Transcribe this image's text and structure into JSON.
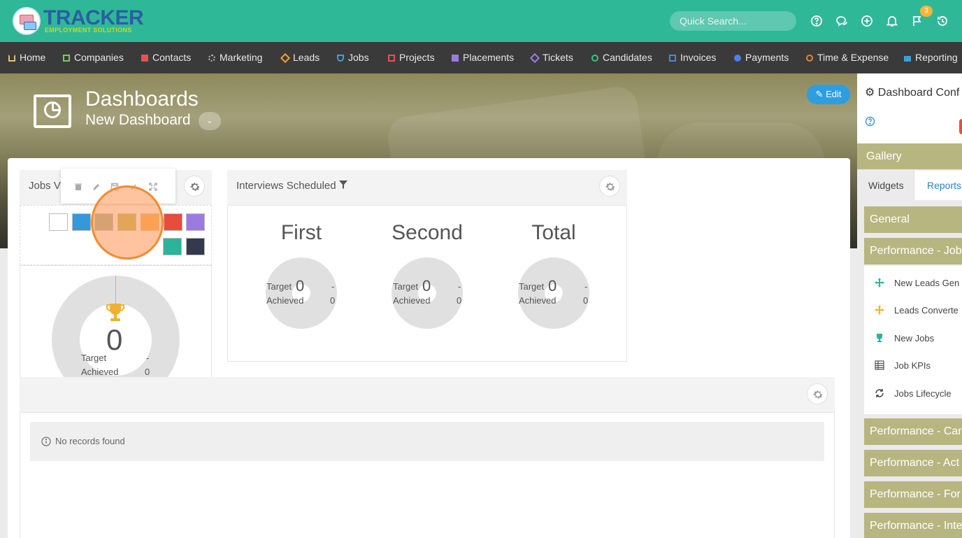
{
  "app": {
    "logo_title": "TRACKER",
    "logo_subtitle": "EMPLOYMENT SOLUTIONS",
    "search_placeholder": "Quick Search...",
    "notification_badge": "3"
  },
  "nav": [
    "Home",
    "Companies",
    "Contacts",
    "Marketing",
    "Leads",
    "Jobs",
    "Projects",
    "Placements",
    "Tickets",
    "Candidates",
    "Invoices",
    "Payments",
    "Time & Expense",
    "Reporting"
  ],
  "hero": {
    "title": "Dashboards",
    "subtitle": "New Dashboard",
    "edit_label": "Edit"
  },
  "widgets": {
    "jobs": {
      "title": "Jobs V",
      "value": "0",
      "target_label": "Target",
      "target_value": "-",
      "achieved_label": "Achieved",
      "achieved_value": "0"
    },
    "interviews": {
      "title": "Interviews Scheduled",
      "columns": [
        {
          "name": "First",
          "value": "0",
          "target_label": "Target",
          "target_value": "-",
          "achieved_label": "Achieved",
          "achieved_value": "0"
        },
        {
          "name": "Second",
          "value": "0",
          "target_label": "Target",
          "target_value": "-",
          "achieved_label": "Achieved",
          "achieved_value": "0"
        },
        {
          "name": "Total",
          "value": "0",
          "target_label": "Target",
          "target_value": "-",
          "achieved_label": "Achieved",
          "achieved_value": "0"
        }
      ]
    },
    "records": {
      "empty_text": "No records found"
    }
  },
  "palette": {
    "colors": [
      "#ffffff",
      "#3498db",
      "#95a58a",
      "#b5b040",
      "#f7a23a",
      "#e74c3c",
      "#9b7be0",
      "#2bb49a",
      "#34394d"
    ]
  },
  "panel": {
    "title": "Dashboard Conf",
    "gallery": "Gallery",
    "tab_widgets": "Widgets",
    "tab_reports": "Reports",
    "sections": [
      "General",
      "Performance - Jobs",
      "Performance - Car",
      "Performance - Act",
      "Performance - For",
      "Performance - Inte"
    ],
    "items": [
      "New Leads Gen",
      "Leads Converte",
      "New Jobs",
      "Job KPIs",
      "Jobs Lifecycle"
    ]
  },
  "colors": {
    "topbar": "#2fb898",
    "nav": "#3a3a3a",
    "accent": "#2d9ee0",
    "section": "#b8b680",
    "highlight": "#f58a2e"
  }
}
